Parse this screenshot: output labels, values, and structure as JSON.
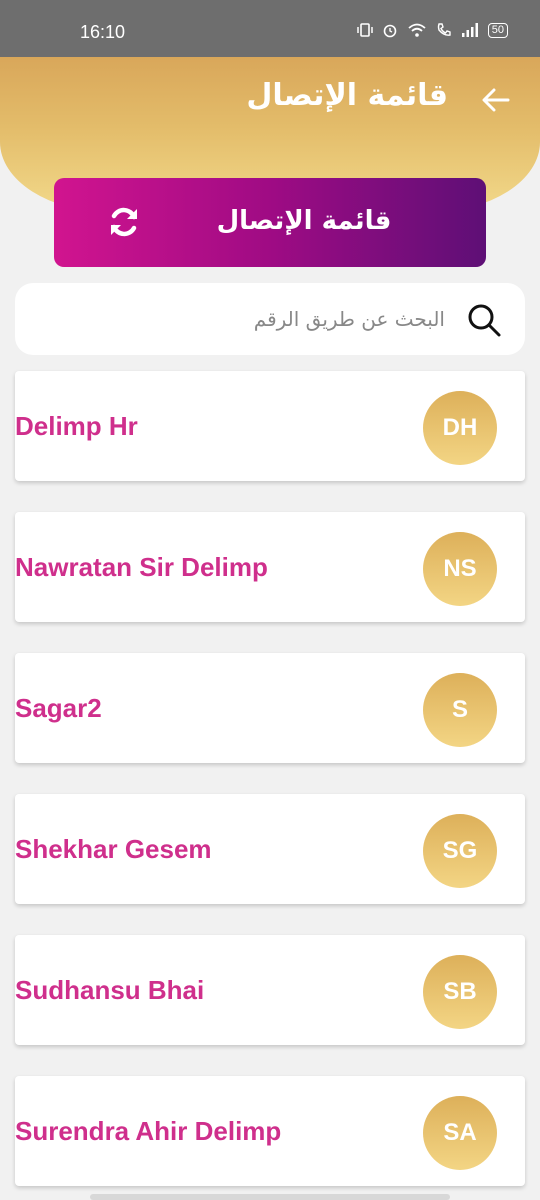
{
  "status_bar": {
    "time": "16:10",
    "battery": "50"
  },
  "header": {
    "title": "قائمة الإتصال",
    "back_icon": "arrow-left-icon"
  },
  "banner": {
    "title": "قائمة الإتصال",
    "refresh_icon": "refresh-icon"
  },
  "search": {
    "placeholder": "البحث عن طريق الرقم",
    "value": ""
  },
  "contacts": [
    {
      "name": "Delimp Hr",
      "initials": "DH"
    },
    {
      "name": "Nawratan Sir Delimp",
      "initials": "NS"
    },
    {
      "name": "Sagar2",
      "initials": "S"
    },
    {
      "name": "Shekhar Gesem",
      "initials": "SG"
    },
    {
      "name": "Sudhansu Bhai",
      "initials": "SB"
    },
    {
      "name": "Surendra Ahir Delimp",
      "initials": "SA"
    }
  ],
  "colors": {
    "header_gradient_top": "#d9a75a",
    "header_gradient_bottom": "#f2d98a",
    "banner_start": "#d1148f",
    "banner_end": "#5e0f76",
    "contact_name": "#cf2f8c"
  }
}
